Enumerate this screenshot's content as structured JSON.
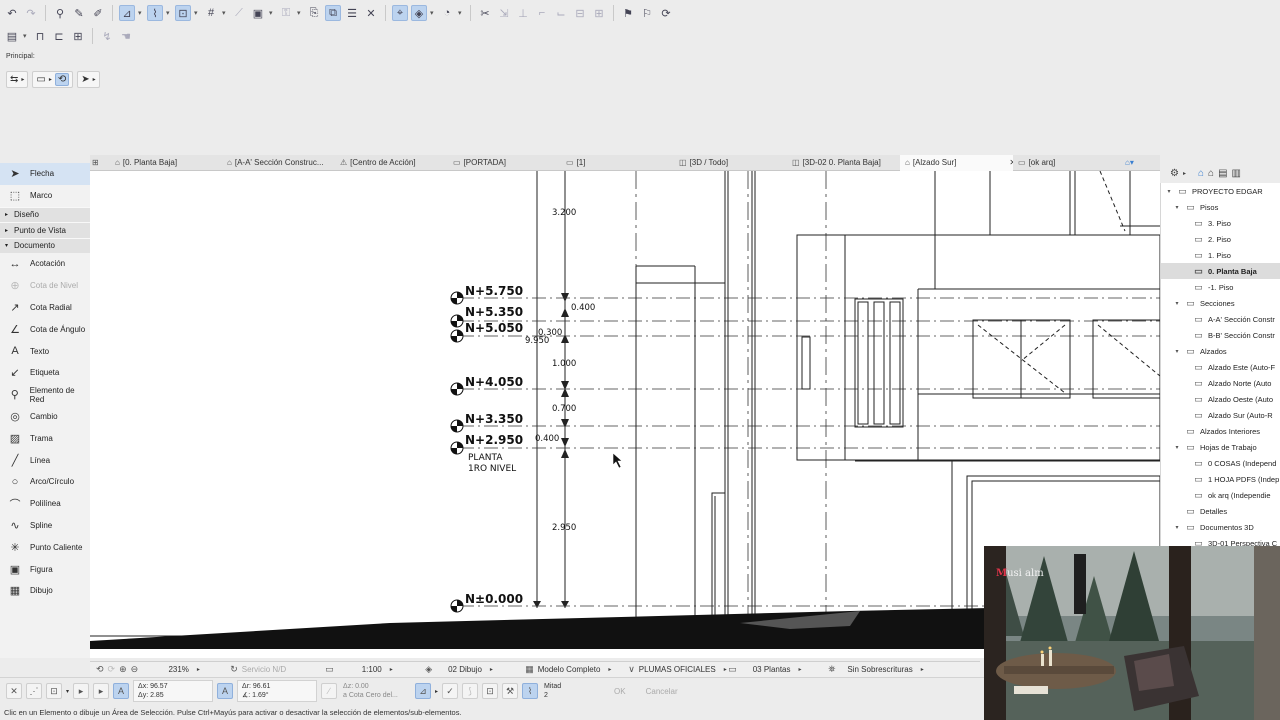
{
  "toolbox": {
    "items_top": [
      {
        "label": "Flecha",
        "icon": "arrow-pointer-icon"
      },
      {
        "label": "Marco",
        "icon": "marquee-icon"
      }
    ],
    "group_diseno": "Diseño",
    "group_punto_vista": "Punto de Vista",
    "group_documento": "Documento",
    "items_doc": [
      {
        "label": "Acotación",
        "icon": "dimension-icon"
      },
      {
        "label": "Cota de Nivel",
        "icon": "level-dimension-icon"
      },
      {
        "label": "Cota Radial",
        "icon": "radial-dimension-icon"
      },
      {
        "label": "Cota de Ángulo",
        "icon": "angle-dimension-icon"
      },
      {
        "label": "Texto",
        "icon": "text-icon"
      },
      {
        "label": "Etiqueta",
        "icon": "label-icon"
      },
      {
        "label": "Elemento de Red",
        "icon": "grid-element-icon"
      },
      {
        "label": "Cambio",
        "icon": "change-icon"
      },
      {
        "label": "Trama",
        "icon": "fill-icon"
      },
      {
        "label": "Línea",
        "icon": "line-icon"
      },
      {
        "label": "Arco/Círculo",
        "icon": "arc-circle-icon"
      },
      {
        "label": "Polilínea",
        "icon": "polyline-icon"
      },
      {
        "label": "Spline",
        "icon": "spline-icon"
      },
      {
        "label": "Punto Caliente",
        "icon": "hotspot-icon"
      },
      {
        "label": "Figura",
        "icon": "figure-icon"
      },
      {
        "label": "Dibujo",
        "icon": "drawing-icon"
      }
    ]
  },
  "principal_label": "Principal:",
  "tabs": [
    {
      "label": "[0. Planta Baja]"
    },
    {
      "label": "[A-A' Sección Construc..."
    },
    {
      "label": "[Centro de Acción]"
    },
    {
      "label": "[PORTADA]"
    },
    {
      "label": "[1]"
    },
    {
      "label": "[3D / Todo]"
    },
    {
      "label": "[3D-02 0. Planta Baja]"
    },
    {
      "label": "[Alzado Sur]"
    },
    {
      "label": "[ok arq]"
    }
  ],
  "drawing": {
    "levels": [
      "N+5.750",
      "N+5.350",
      "N+5.050",
      "N+4.050",
      "N+3.350",
      "N+2.950",
      "N±0.000"
    ],
    "dims": [
      "3.200",
      "0.400",
      "0.300",
      "9.950",
      "1.000",
      "0.700",
      "0.400",
      "2.950"
    ],
    "note_line1": "PLANTA",
    "note_line2": "1RO NIVEL"
  },
  "navigator": {
    "rows": [
      {
        "label": "PROYECTO EDGAR",
        "depth": 0,
        "caret": "▾",
        "icon": "project-icon"
      },
      {
        "label": "Pisos",
        "depth": 1,
        "caret": "▾",
        "icon": "folder-icon"
      },
      {
        "label": "3. Piso",
        "depth": 2,
        "caret": "",
        "icon": "story-icon"
      },
      {
        "label": "2. Piso",
        "depth": 2,
        "caret": "",
        "icon": "story-icon"
      },
      {
        "label": "1. Piso",
        "depth": 2,
        "caret": "",
        "icon": "story-icon"
      },
      {
        "label": "0. Planta Baja",
        "depth": 2,
        "caret": "",
        "icon": "story-icon",
        "selected": true
      },
      {
        "label": "-1. Piso",
        "depth": 2,
        "caret": "",
        "icon": "story-icon"
      },
      {
        "label": "Secciones",
        "depth": 1,
        "caret": "▾",
        "icon": "folder-icon"
      },
      {
        "label": "A-A' Sección Constr",
        "depth": 2,
        "caret": "",
        "icon": "section-icon"
      },
      {
        "label": "B-B' Sección Constr",
        "depth": 2,
        "caret": "",
        "icon": "section-icon"
      },
      {
        "label": "Alzados",
        "depth": 1,
        "caret": "▾",
        "icon": "folder-icon"
      },
      {
        "label": "Alzado Este (Auto-F",
        "depth": 2,
        "caret": "",
        "icon": "elevation-icon"
      },
      {
        "label": "Alzado Norte (Auto",
        "depth": 2,
        "caret": "",
        "icon": "elevation-icon"
      },
      {
        "label": "Alzado Oeste (Auto",
        "depth": 2,
        "caret": "",
        "icon": "elevation-icon"
      },
      {
        "label": "Alzado Sur (Auto-R",
        "depth": 2,
        "caret": "",
        "icon": "elevation-icon"
      },
      {
        "label": "Alzados Interiores",
        "depth": 1,
        "caret": "",
        "icon": "interior-elevation-icon"
      },
      {
        "label": "Hojas de Trabajo",
        "depth": 1,
        "caret": "▾",
        "icon": "worksheet-folder-icon"
      },
      {
        "label": "0 COSAS (Independ",
        "depth": 2,
        "caret": "",
        "icon": "worksheet-icon"
      },
      {
        "label": "1 HOJA PDFS (Indep",
        "depth": 2,
        "caret": "",
        "icon": "worksheet-icon"
      },
      {
        "label": "ok arq  (Independie",
        "depth": 2,
        "caret": "",
        "icon": "worksheet-icon"
      },
      {
        "label": "Detalles",
        "depth": 1,
        "caret": "",
        "icon": "details-icon"
      },
      {
        "label": "Documentos 3D",
        "depth": 1,
        "caret": "▾",
        "icon": "3d-doc-icon"
      },
      {
        "label": "3D-01 Perspectiva C",
        "depth": 2,
        "caret": "",
        "icon": "3d-doc-icon"
      }
    ]
  },
  "video": {
    "label_m": "M",
    "label_rest": "usi alm"
  },
  "viewbar": {
    "zoom": "231%",
    "service": "Servicio N/D",
    "scale": "1:100",
    "layer": "02 Dibujo",
    "model": "Modelo Completo",
    "pens": "PLUMAS OFICIALES",
    "plans": "03 Plantas",
    "overrides": "Sin Sobrescrituras"
  },
  "infobar": {
    "dx": "Δx: 96.57",
    "dy": "Δy: 2.85",
    "dr": "Δr: 96.61",
    "da": "∡: 1.69°",
    "dz": "Δz: 0.00",
    "ref": "a Cota Cero del...",
    "mitad": "Mitad",
    "mitad_val": "2",
    "ok": "OK",
    "cancel": "Cancelar"
  },
  "status": "Clic en un Elemento o dibuje un Área de Selección. Pulse Ctrl+Mayús para activar o desactivar la selección de elementos/sub-elementos."
}
